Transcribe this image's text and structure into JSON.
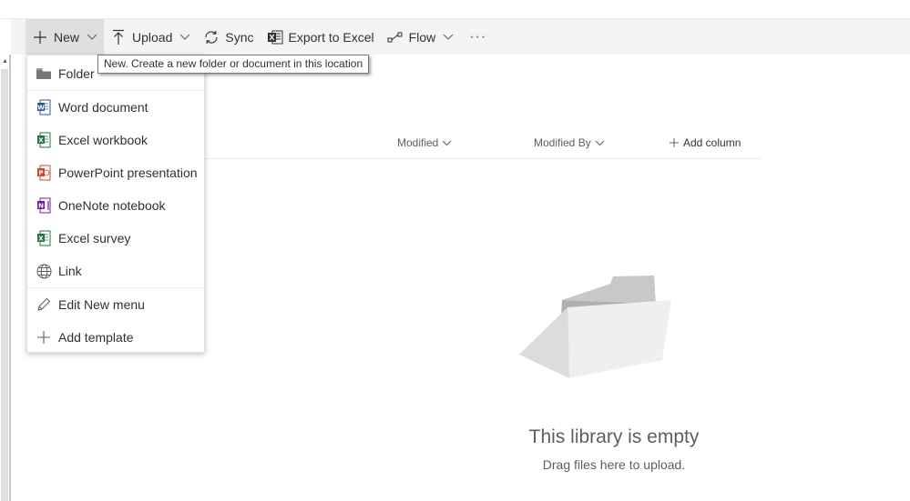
{
  "commandbar": {
    "new_label": "New",
    "upload_label": "Upload",
    "sync_label": "Sync",
    "export_label": "Export to Excel",
    "flow_label": "Flow",
    "more_label": "···"
  },
  "tooltip": {
    "text": "New. Create a new folder or document in this location"
  },
  "new_menu": {
    "items": [
      {
        "label": "Folder",
        "icon": "folder-icon"
      },
      {
        "label": "Word document",
        "icon": "word-icon"
      },
      {
        "label": "Excel workbook",
        "icon": "excel-icon"
      },
      {
        "label": "PowerPoint presentation",
        "icon": "powerpoint-icon"
      },
      {
        "label": "OneNote notebook",
        "icon": "onenote-icon"
      },
      {
        "label": "Excel survey",
        "icon": "excel-icon"
      },
      {
        "label": "Link",
        "icon": "globe-icon"
      },
      {
        "label": "Edit New menu",
        "icon": "pencil-icon"
      },
      {
        "label": "Add template",
        "icon": "plus-icon"
      }
    ]
  },
  "columns": {
    "modified": "Modified",
    "modified_by": "Modified By",
    "add_column": "Add column"
  },
  "empty_state": {
    "title": "This library is empty",
    "subtitle": "Drag files here to upload."
  },
  "colors": {
    "word": "#2b579a",
    "excel": "#217346",
    "powerpoint": "#d24726",
    "onenote": "#7719aa",
    "folder": "#797775"
  }
}
